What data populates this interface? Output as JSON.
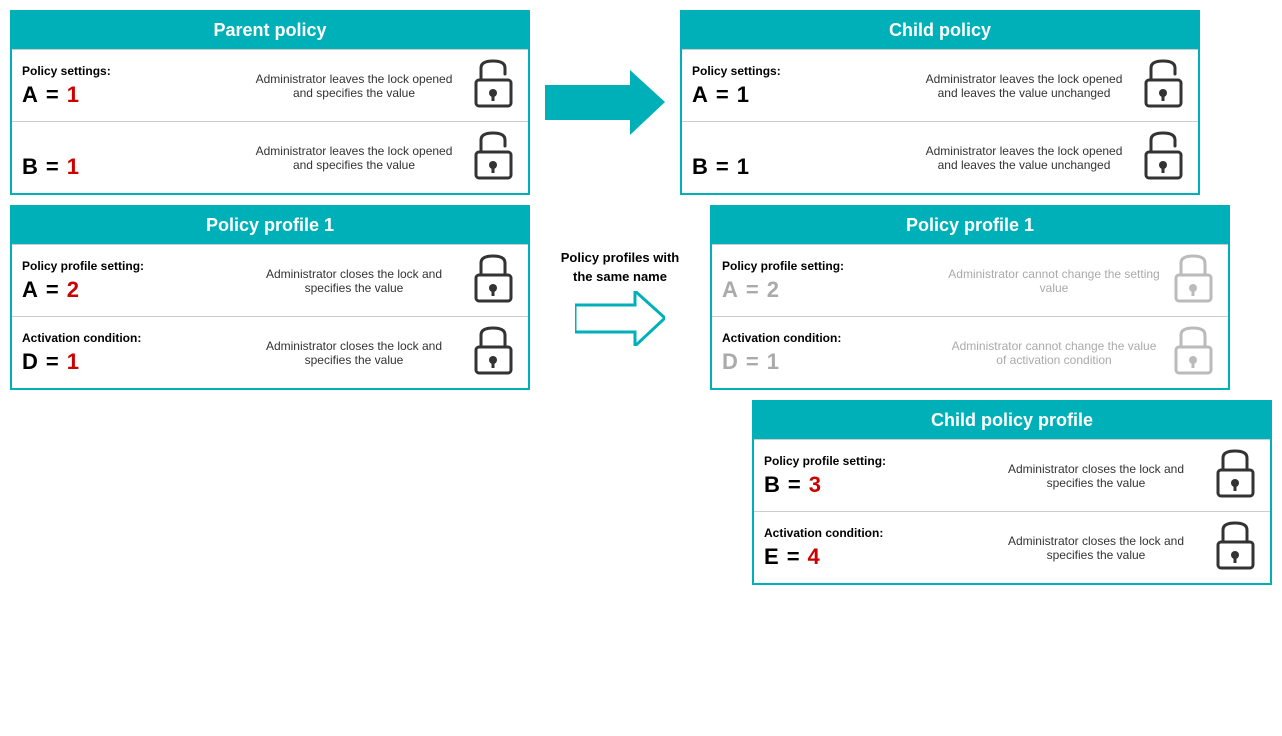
{
  "parentPolicy": {
    "title": "Parent policy",
    "rows": [
      {
        "label": "Policy settings:",
        "variable": "A",
        "equals": "=",
        "value": "1",
        "valueColor": "red",
        "description": "Administrator leaves the lock opened and specifies the value",
        "lockType": "open"
      },
      {
        "label": "",
        "variable": "B",
        "equals": "=",
        "value": "1",
        "valueColor": "red",
        "description": "Administrator leaves the lock opened and specifies the value",
        "lockType": "open"
      }
    ]
  },
  "childPolicy": {
    "title": "Child policy",
    "rows": [
      {
        "label": "Policy settings:",
        "variable": "A",
        "equals": "=",
        "value": "1",
        "valueColor": "black",
        "description": "Administrator leaves the lock opened and leaves the value unchanged",
        "lockType": "open"
      },
      {
        "label": "",
        "variable": "B",
        "equals": "=",
        "value": "1",
        "valueColor": "black",
        "description": "Administrator leaves the lock opened and leaves the value unchanged",
        "lockType": "open"
      }
    ]
  },
  "policyProfile1Parent": {
    "title": "Policy profile 1",
    "rows": [
      {
        "label": "Policy profile setting:",
        "variable": "A",
        "equals": "=",
        "value": "2",
        "valueColor": "red",
        "description": "Administrator closes the lock and specifies the value",
        "lockType": "closed"
      },
      {
        "label": "Activation condition:",
        "variable": "D",
        "equals": "=",
        "value": "1",
        "valueColor": "red",
        "description": "Administrator closes the lock and specifies the value",
        "lockType": "closed"
      }
    ]
  },
  "policyProfile1Child": {
    "title": "Policy profile 1",
    "rows": [
      {
        "label": "Policy profile setting:",
        "variable": "A",
        "equals": "=",
        "value": "2",
        "valueColor": "gray",
        "description": "Administrator cannot change the setting value",
        "lockType": "closed-gray"
      },
      {
        "label": "Activation condition:",
        "variable": "D",
        "equals": "=",
        "value": "1",
        "valueColor": "gray",
        "description": "Administrator cannot change the value of activation condition",
        "lockType": "closed-gray"
      }
    ]
  },
  "childPolicyProfile": {
    "title": "Child policy profile",
    "rows": [
      {
        "label": "Policy profile setting:",
        "variable": "B",
        "equals": "=",
        "value": "3",
        "valueColor": "red",
        "description": "Administrator closes the lock and specifies the value",
        "lockType": "closed"
      },
      {
        "label": "Activation condition:",
        "variable": "E",
        "equals": "=",
        "value": "4",
        "valueColor": "red",
        "description": "Administrator closes the lock and specifies the value",
        "lockType": "closed"
      }
    ]
  },
  "middleLabel": "Policy profiles with\nthe same name"
}
